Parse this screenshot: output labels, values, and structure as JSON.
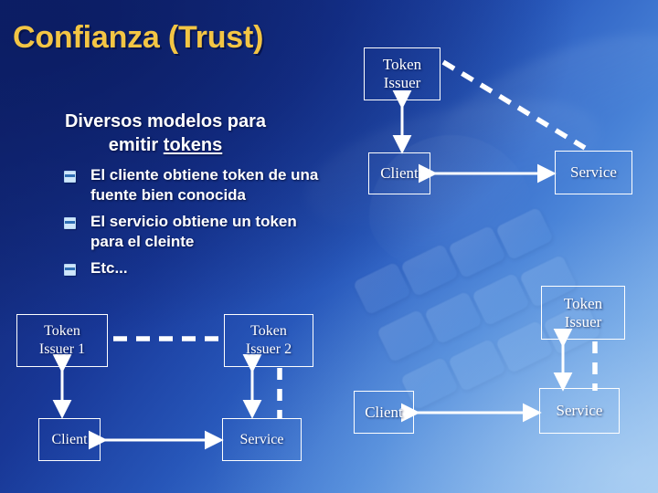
{
  "slide": {
    "title": "Confianza (Trust)",
    "subtitle_line1": "Diversos modelos para",
    "subtitle_line2_pre": "emitir ",
    "subtitle_line2_underlined": "tokens",
    "title_color": "#f3c544",
    "text_color": "#ffffff",
    "background_colors": [
      "#10246e",
      "#1b3ea3",
      "#4a84d8",
      "#9cc4ef"
    ]
  },
  "bullets": [
    {
      "marker": "square-bullet-icon",
      "text": "El cliente obtiene token de una fuente bien conocida"
    },
    {
      "marker": "square-bullet-icon",
      "text": "El servicio obtiene un token para el cleinte"
    },
    {
      "marker": "square-bullet-icon",
      "text": "Etc..."
    }
  ],
  "diagrams": [
    {
      "id": "diagram-top-right",
      "nodes": [
        {
          "id": "token-issuer",
          "label_line1": "Token",
          "label_line2": "Issuer"
        },
        {
          "id": "client",
          "label_line1": "Client",
          "label_line2": ""
        },
        {
          "id": "service",
          "label_line1": "Service",
          "label_line2": ""
        }
      ],
      "connections": [
        {
          "from": "token-issuer",
          "to": "client",
          "style": "solid",
          "arrows": "both"
        },
        {
          "from": "client",
          "to": "service",
          "style": "solid",
          "arrows": "both"
        },
        {
          "from": "token-issuer",
          "to": "service",
          "style": "dashed",
          "arrows": "none"
        }
      ]
    },
    {
      "id": "diagram-bottom-left",
      "nodes": [
        {
          "id": "token-issuer-1",
          "label_line1": "Token",
          "label_line2": "Issuer 1"
        },
        {
          "id": "token-issuer-2",
          "label_line1": "Token",
          "label_line2": "Issuer 2"
        },
        {
          "id": "client",
          "label_line1": "Client",
          "label_line2": ""
        },
        {
          "id": "service",
          "label_line1": "Service",
          "label_line2": ""
        }
      ],
      "connections": [
        {
          "from": "token-issuer-1",
          "to": "token-issuer-2",
          "style": "dashed",
          "arrows": "none"
        },
        {
          "from": "token-issuer-1",
          "to": "client",
          "style": "solid",
          "arrows": "both"
        },
        {
          "from": "token-issuer-2",
          "to": "service",
          "style": "solid",
          "arrows": "both"
        },
        {
          "from": "token-issuer-2",
          "to": "service",
          "style": "dashed",
          "arrows": "none"
        },
        {
          "from": "client",
          "to": "service",
          "style": "solid",
          "arrows": "both"
        }
      ]
    },
    {
      "id": "diagram-bottom-right",
      "nodes": [
        {
          "id": "token-issuer",
          "label_line1": "Token",
          "label_line2": "Issuer"
        },
        {
          "id": "client",
          "label_line1": "Client",
          "label_line2": ""
        },
        {
          "id": "service",
          "label_line1": "Service",
          "label_line2": ""
        }
      ],
      "connections": [
        {
          "from": "token-issuer",
          "to": "service",
          "style": "solid",
          "arrows": "both"
        },
        {
          "from": "token-issuer",
          "to": "service",
          "style": "dashed",
          "arrows": "none"
        },
        {
          "from": "client",
          "to": "service",
          "style": "solid",
          "arrows": "both"
        }
      ]
    }
  ]
}
